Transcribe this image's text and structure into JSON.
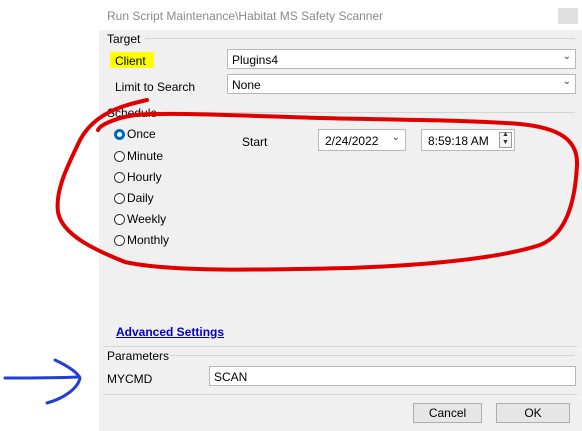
{
  "window": {
    "title": "Run Script Maintenance\\Habitat MS Safety Scanner"
  },
  "target": {
    "group_label": "Target",
    "client_label": "Client",
    "client_value": "Plugins4",
    "limit_label": "Limit to Search",
    "limit_value": "None"
  },
  "schedule": {
    "group_label": "Schedule",
    "options": [
      "Once",
      "Minute",
      "Hourly",
      "Daily",
      "Weekly",
      "Monthly"
    ],
    "selected": "Once",
    "start_label": "Start",
    "start_date": "2/24/2022",
    "start_time": "8:59:18 AM"
  },
  "advanced_settings_link": "Advanced Settings",
  "parameters": {
    "group_label": "Parameters",
    "name": "MYCMD",
    "value": "SCAN"
  },
  "buttons": {
    "cancel": "Cancel",
    "ok": "OK"
  },
  "colors": {
    "highlight": "#ffff00",
    "annotation_red": "#e00000",
    "annotation_blue": "#1f3fd6",
    "link": "#0000cc",
    "radio_selected": "#0067c0"
  }
}
